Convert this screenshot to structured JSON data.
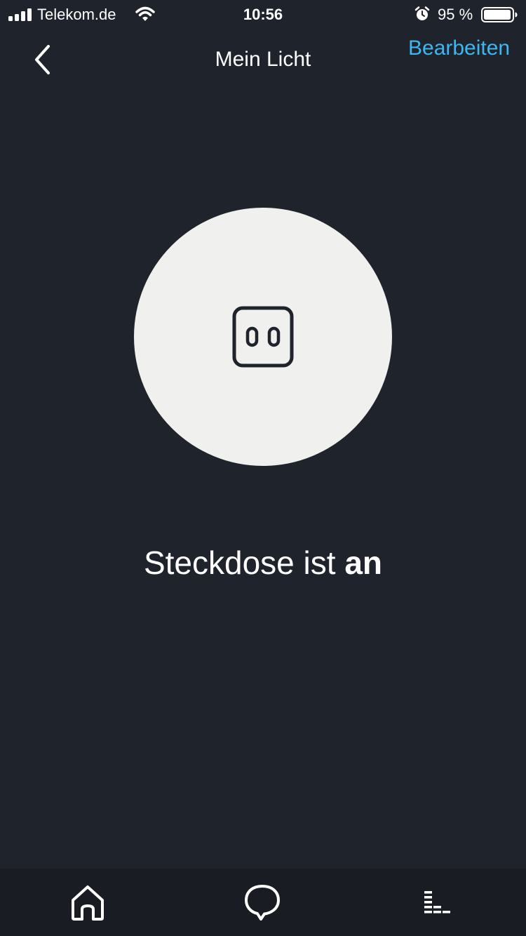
{
  "status_bar": {
    "carrier": "Telekom.de",
    "time": "10:56",
    "battery_percent": "95 %",
    "icons": [
      "signal-icon",
      "wifi-icon",
      "alarm-icon",
      "battery-icon"
    ]
  },
  "nav": {
    "back_icon": "chevron-left-icon",
    "title": "Mein Licht",
    "edit_label": "Bearbeiten"
  },
  "device": {
    "icon": "power-socket-icon",
    "status_prefix": "Steckdose ist ",
    "status_value": "an"
  },
  "tabs": [
    {
      "name": "home",
      "icon": "home-icon"
    },
    {
      "name": "communicate",
      "icon": "chat-bubble-icon"
    },
    {
      "name": "play",
      "icon": "equalizer-icon"
    }
  ],
  "colors": {
    "background": "#1f232c",
    "tab_bar": "#191c22",
    "accent": "#3fb6f0",
    "circle": "#f0f0ee"
  }
}
